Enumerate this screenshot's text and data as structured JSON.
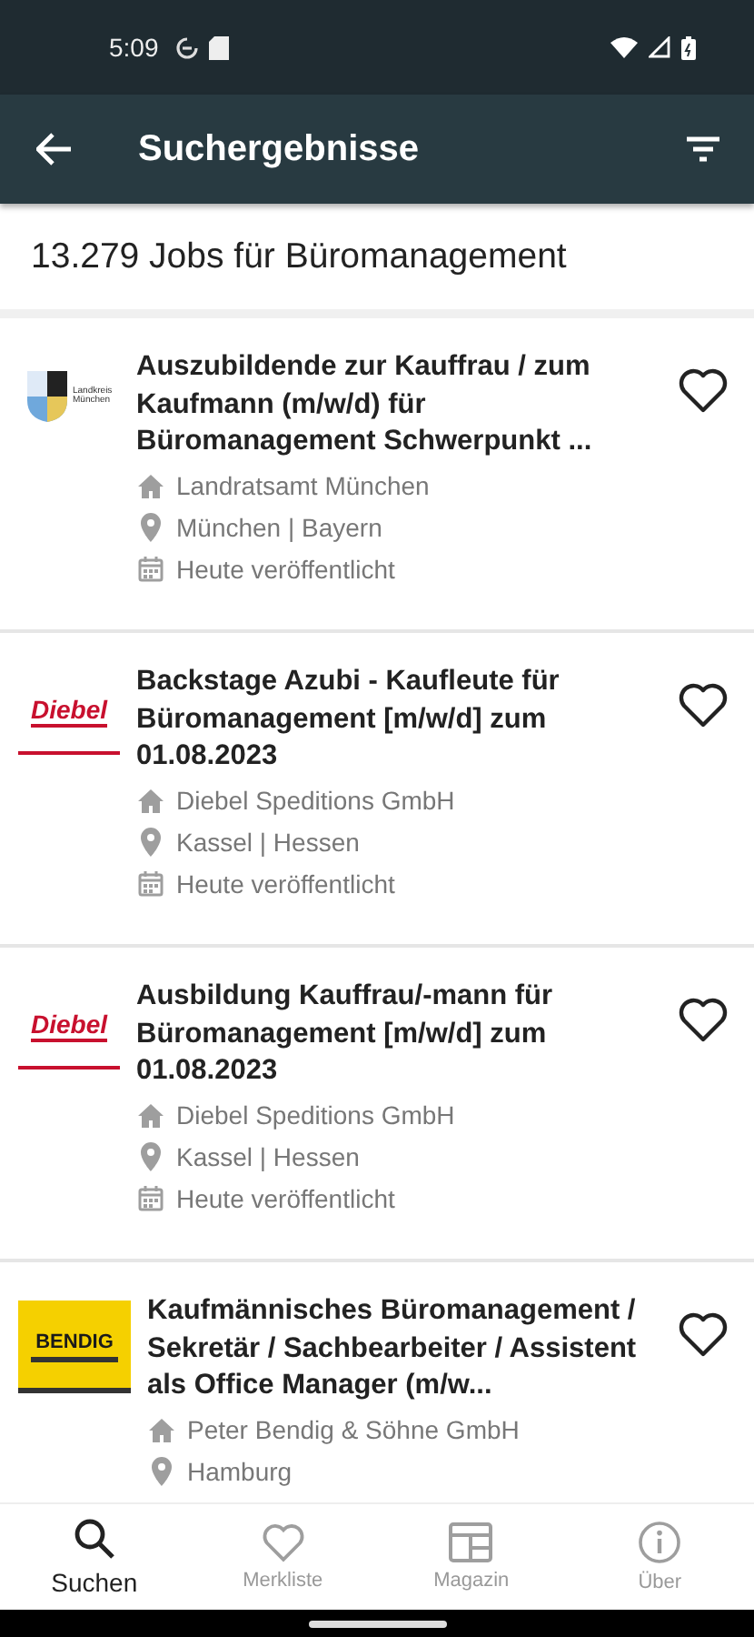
{
  "status_bar": {
    "time": "5:09"
  },
  "app_bar": {
    "title": "Suchergebnisse"
  },
  "result_count": "13.279 Jobs für Büromanagement",
  "jobs": [
    {
      "logo": {
        "kind": "shield",
        "text": "Landkreis München"
      },
      "title": "Auszubildende zur Kauffrau / zum Kaufmann (m/w/d) für Büromanagement Schwerpunkt ...",
      "company": "Landratsamt München",
      "location": "München | Bayern",
      "date": "Heute veröffentlicht",
      "saved": false
    },
    {
      "logo": {
        "kind": "red",
        "text": "Diebel"
      },
      "title": "Backstage Azubi - Kaufleute für Büromanagement [m/w/d] zum 01.08.2023",
      "company": "Diebel Speditions GmbH",
      "location": "Kassel | Hessen",
      "date": "Heute veröffentlicht",
      "saved": false
    },
    {
      "logo": {
        "kind": "red",
        "text": "Diebel"
      },
      "title": "Ausbildung Kauffrau/-mann für Büromanagement [m/w/d] zum 01.08.2023",
      "company": "Diebel Speditions GmbH",
      "location": "Kassel | Hessen",
      "date": "Heute veröffentlicht",
      "saved": false
    },
    {
      "logo": {
        "kind": "yellow",
        "text": "BENDIG"
      },
      "title": "Kaufmännisches Büromanagement / Sekretär / Sachbearbeiter / Assistent als Office Manager (m/w...",
      "company": "Peter Bendig & Söhne GmbH",
      "location": "Hamburg",
      "saved": false
    }
  ],
  "bottom_nav": [
    {
      "kind": "search",
      "label": "Suchen",
      "selected": true
    },
    {
      "kind": "heart",
      "label": "Merkliste",
      "selected": false
    },
    {
      "kind": "magazine",
      "label": "Magazin",
      "selected": false
    },
    {
      "kind": "info",
      "label": "Über",
      "selected": false
    }
  ]
}
